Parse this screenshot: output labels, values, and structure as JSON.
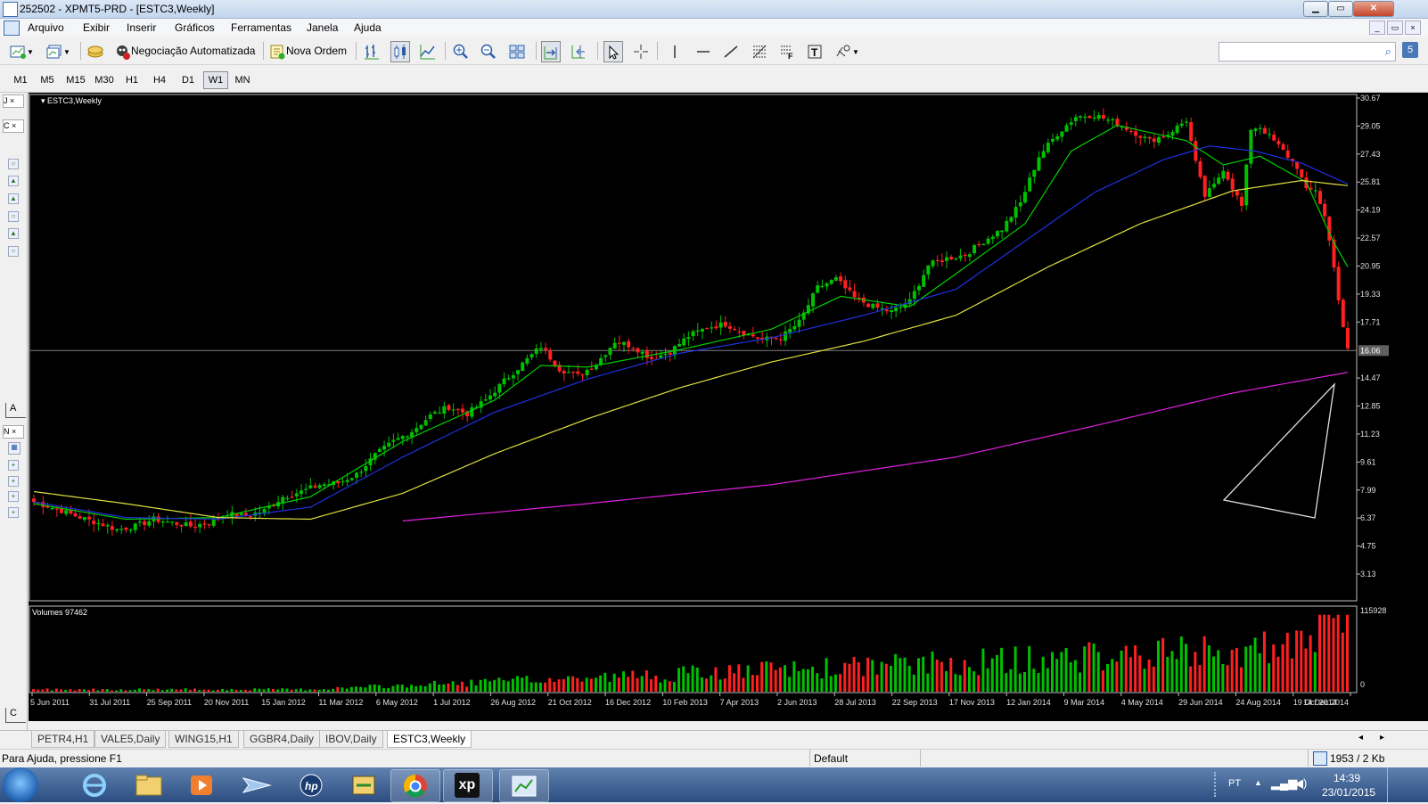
{
  "window": {
    "title": "252502 - XPMT5-PRD - [ESTC3,Weekly]",
    "min": "▁",
    "max": "▭",
    "close": "✕"
  },
  "menu": {
    "items": [
      "Arquivo",
      "Exibir",
      "Inserir",
      "Gráficos",
      "Ferramentas",
      "Janela",
      "Ajuda"
    ]
  },
  "toolbar": {
    "auto_trading": "Negociação Automatizada",
    "new_order": "Nova Ordem",
    "help_icon_label": "5"
  },
  "timeframes": {
    "items": [
      "M1",
      "M5",
      "M15",
      "M30",
      "H1",
      "H4",
      "D1",
      "W1",
      "MN"
    ],
    "active": "W1"
  },
  "left_panel": {
    "tab1": "J",
    "tab2": "C",
    "tab3": "N",
    "tab_a": "A",
    "tab_c": "C"
  },
  "chart": {
    "symbol_label": "ESTC3,Weekly",
    "price_axis": [
      "30.67",
      "29.05",
      "27.43",
      "25.81",
      "24.19",
      "22.57",
      "20.95",
      "19.33",
      "17.71",
      "16.06",
      "14.47",
      "12.85",
      "11.23",
      "9.61",
      "7.99",
      "6.37",
      "4.75",
      "3.13"
    ],
    "current_price": "16.06",
    "volume_label": "Volumes 97462",
    "volume_axis": [
      "115928",
      "0"
    ],
    "date_axis": [
      "5 Jun 2011",
      "31 Jul 2011",
      "25 Sep 2011",
      "20 Nov 2011",
      "15 Jan 2012",
      "11 Mar 2012",
      "6 May 2012",
      "1 Jul 2012",
      "26 Aug 2012",
      "21 Oct 2012",
      "16 Dec 2012",
      "10 Feb 2013",
      "7 Apr 2013",
      "2 Jun 2013",
      "28 Jul 2013",
      "22 Sep 2013",
      "17 Nov 2013",
      "12 Jan 2014",
      "9 Mar 2014",
      "4 May 2014",
      "29 Jun 2014",
      "24 Aug 2014",
      "19 Oct 2014",
      "14 Dec 2014"
    ],
    "colors": {
      "bull": "#00c000",
      "bear": "#ff2020",
      "ma_fast": "#00d000",
      "ma_mid": "#2030e0",
      "ma_slow": "#e0e040",
      "ma_long": "#e020e0",
      "line": "#808080"
    }
  },
  "chart_data": {
    "type": "candlestick",
    "symbol": "ESTC3",
    "timeframe": "Weekly",
    "y_range": [
      3.13,
      30.67
    ],
    "current_price": 16.06,
    "price_path": [
      [
        0,
        7.3
      ],
      [
        6,
        6.8
      ],
      [
        10,
        6.4
      ],
      [
        15,
        6.0
      ],
      [
        18,
        5.7
      ],
      [
        22,
        5.9
      ],
      [
        26,
        6.3
      ],
      [
        30,
        6.1
      ],
      [
        34,
        5.9
      ],
      [
        38,
        6.1
      ],
      [
        42,
        6.6
      ],
      [
        46,
        6.5
      ],
      [
        50,
        6.8
      ],
      [
        54,
        7.6
      ],
      [
        58,
        7.9
      ],
      [
        62,
        8.3
      ],
      [
        66,
        8.4
      ],
      [
        70,
        8.9
      ],
      [
        74,
        10.0
      ],
      [
        78,
        10.8
      ],
      [
        82,
        11.4
      ],
      [
        86,
        12.3
      ],
      [
        90,
        12.8
      ],
      [
        94,
        12.4
      ],
      [
        98,
        13.2
      ],
      [
        102,
        14.3
      ],
      [
        106,
        15.3
      ],
      [
        110,
        16.3
      ],
      [
        114,
        15.0
      ],
      [
        118,
        14.6
      ],
      [
        122,
        15.3
      ],
      [
        126,
        16.6
      ],
      [
        130,
        16.3
      ],
      [
        134,
        15.6
      ],
      [
        138,
        16.0
      ],
      [
        142,
        16.9
      ],
      [
        146,
        17.4
      ],
      [
        150,
        17.6
      ],
      [
        154,
        17.1
      ],
      [
        158,
        16.7
      ],
      [
        162,
        16.8
      ],
      [
        166,
        17.7
      ],
      [
        170,
        19.7
      ],
      [
        174,
        20.2
      ],
      [
        178,
        19.1
      ],
      [
        182,
        18.6
      ],
      [
        186,
        18.3
      ],
      [
        190,
        18.9
      ],
      [
        194,
        21.0
      ],
      [
        198,
        21.4
      ],
      [
        202,
        21.6
      ],
      [
        206,
        22.4
      ],
      [
        210,
        23.1
      ],
      [
        214,
        24.6
      ],
      [
        218,
        27.3
      ],
      [
        222,
        28.6
      ],
      [
        226,
        29.6
      ],
      [
        230,
        29.7
      ],
      [
        234,
        29.3
      ],
      [
        238,
        28.8
      ],
      [
        242,
        28.2
      ],
      [
        246,
        28.6
      ],
      [
        250,
        29.4
      ],
      [
        252,
        26.9
      ],
      [
        254,
        25.0
      ],
      [
        256,
        25.6
      ],
      [
        258,
        26.6
      ],
      [
        262,
        24.4
      ],
      [
        264,
        28.9
      ],
      [
        266,
        29.0
      ],
      [
        270,
        27.9
      ],
      [
        274,
        26.7
      ],
      [
        276,
        25.3
      ],
      [
        278,
        25.4
      ],
      [
        280,
        23.8
      ],
      [
        282,
        21.0
      ],
      [
        283,
        19.0
      ],
      [
        284,
        17.3
      ],
      [
        285,
        16.1
      ]
    ],
    "moving_averages": [
      {
        "name": "fast",
        "points": [
          [
            0,
            7.2
          ],
          [
            20,
            6.3
          ],
          [
            40,
            6.4
          ],
          [
            60,
            7.6
          ],
          [
            80,
            10.8
          ],
          [
            100,
            13.2
          ],
          [
            110,
            15.2
          ],
          [
            120,
            15.1
          ],
          [
            140,
            16.1
          ],
          [
            160,
            17.3
          ],
          [
            175,
            19.2
          ],
          [
            190,
            18.6
          ],
          [
            200,
            20.5
          ],
          [
            215,
            23.4
          ],
          [
            225,
            27.6
          ],
          [
            235,
            29.1
          ],
          [
            250,
            28.2
          ],
          [
            258,
            26.8
          ],
          [
            266,
            27.3
          ],
          [
            276,
            25.8
          ],
          [
            282,
            22.3
          ],
          [
            285,
            20.9
          ]
        ]
      },
      {
        "name": "mid",
        "points": [
          [
            0,
            7.3
          ],
          [
            20,
            6.4
          ],
          [
            40,
            6.3
          ],
          [
            60,
            7.0
          ],
          [
            80,
            9.9
          ],
          [
            100,
            12.5
          ],
          [
            120,
            14.4
          ],
          [
            140,
            15.9
          ],
          [
            160,
            16.8
          ],
          [
            180,
            18.1
          ],
          [
            200,
            19.6
          ],
          [
            215,
            22.4
          ],
          [
            230,
            25.2
          ],
          [
            245,
            27.1
          ],
          [
            255,
            27.9
          ],
          [
            265,
            27.6
          ],
          [
            275,
            26.9
          ],
          [
            285,
            25.7
          ]
        ]
      },
      {
        "name": "slow",
        "points": [
          [
            0,
            7.9
          ],
          [
            20,
            7.2
          ],
          [
            40,
            6.4
          ],
          [
            60,
            6.3
          ],
          [
            80,
            7.8
          ],
          [
            100,
            10.1
          ],
          [
            120,
            12.1
          ],
          [
            140,
            13.9
          ],
          [
            160,
            15.4
          ],
          [
            180,
            16.6
          ],
          [
            200,
            18.1
          ],
          [
            220,
            20.9
          ],
          [
            240,
            23.4
          ],
          [
            260,
            25.3
          ],
          [
            275,
            25.9
          ],
          [
            285,
            25.6
          ]
        ]
      },
      {
        "name": "long",
        "points": [
          [
            80,
            6.2
          ],
          [
            120,
            7.2
          ],
          [
            160,
            8.3
          ],
          [
            200,
            9.9
          ],
          [
            230,
            11.7
          ],
          [
            260,
            13.6
          ],
          [
            285,
            14.8
          ]
        ]
      }
    ]
  },
  "tabs": {
    "items": [
      "PETR4,H1",
      "VALE5,Daily",
      "WING15,H1",
      "GGBR4,Daily",
      "IBOV,Daily",
      "ESTC3,Weekly"
    ],
    "active": "ESTC3,Weekly"
  },
  "status": {
    "help": "Para Ajuda, pressione F1",
    "profile": "Default",
    "traffic": "1953 / 2 Kb"
  },
  "taskbar": {
    "lang": "PT",
    "time": "14:39",
    "date": "23/01/2015",
    "xp_label": "xp"
  }
}
